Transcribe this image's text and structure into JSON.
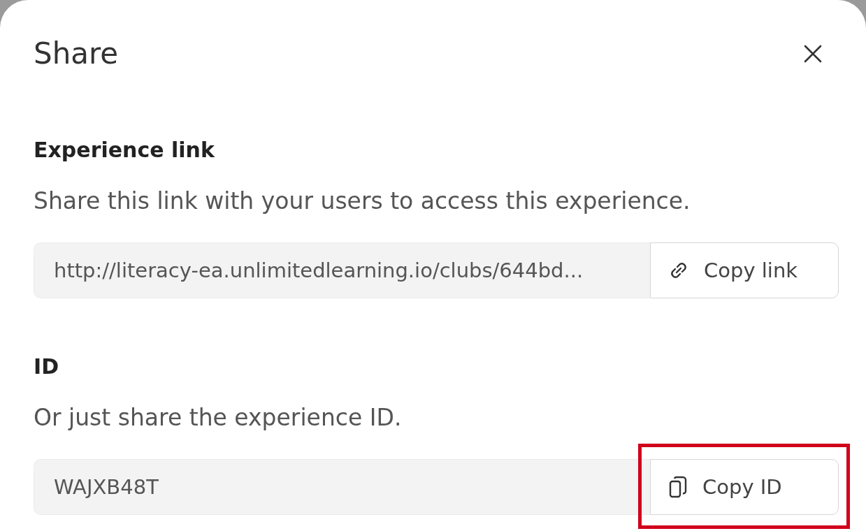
{
  "dialog": {
    "title": "Share"
  },
  "sections": [
    {
      "heading": "Experience link",
      "description": "Share this link with your users to access this experience.",
      "field": {
        "value": "http://literacy-ea.unlimitedlearning.io/clubs/644bd..."
      },
      "button": {
        "label": "Copy link",
        "kind": "link",
        "highlighted": false
      }
    },
    {
      "heading": "ID",
      "description": "Or just share the experience ID.",
      "field": {
        "value": "WAJXB48T"
      },
      "button": {
        "label": "Copy ID",
        "kind": "copy",
        "highlighted": true
      }
    }
  ]
}
